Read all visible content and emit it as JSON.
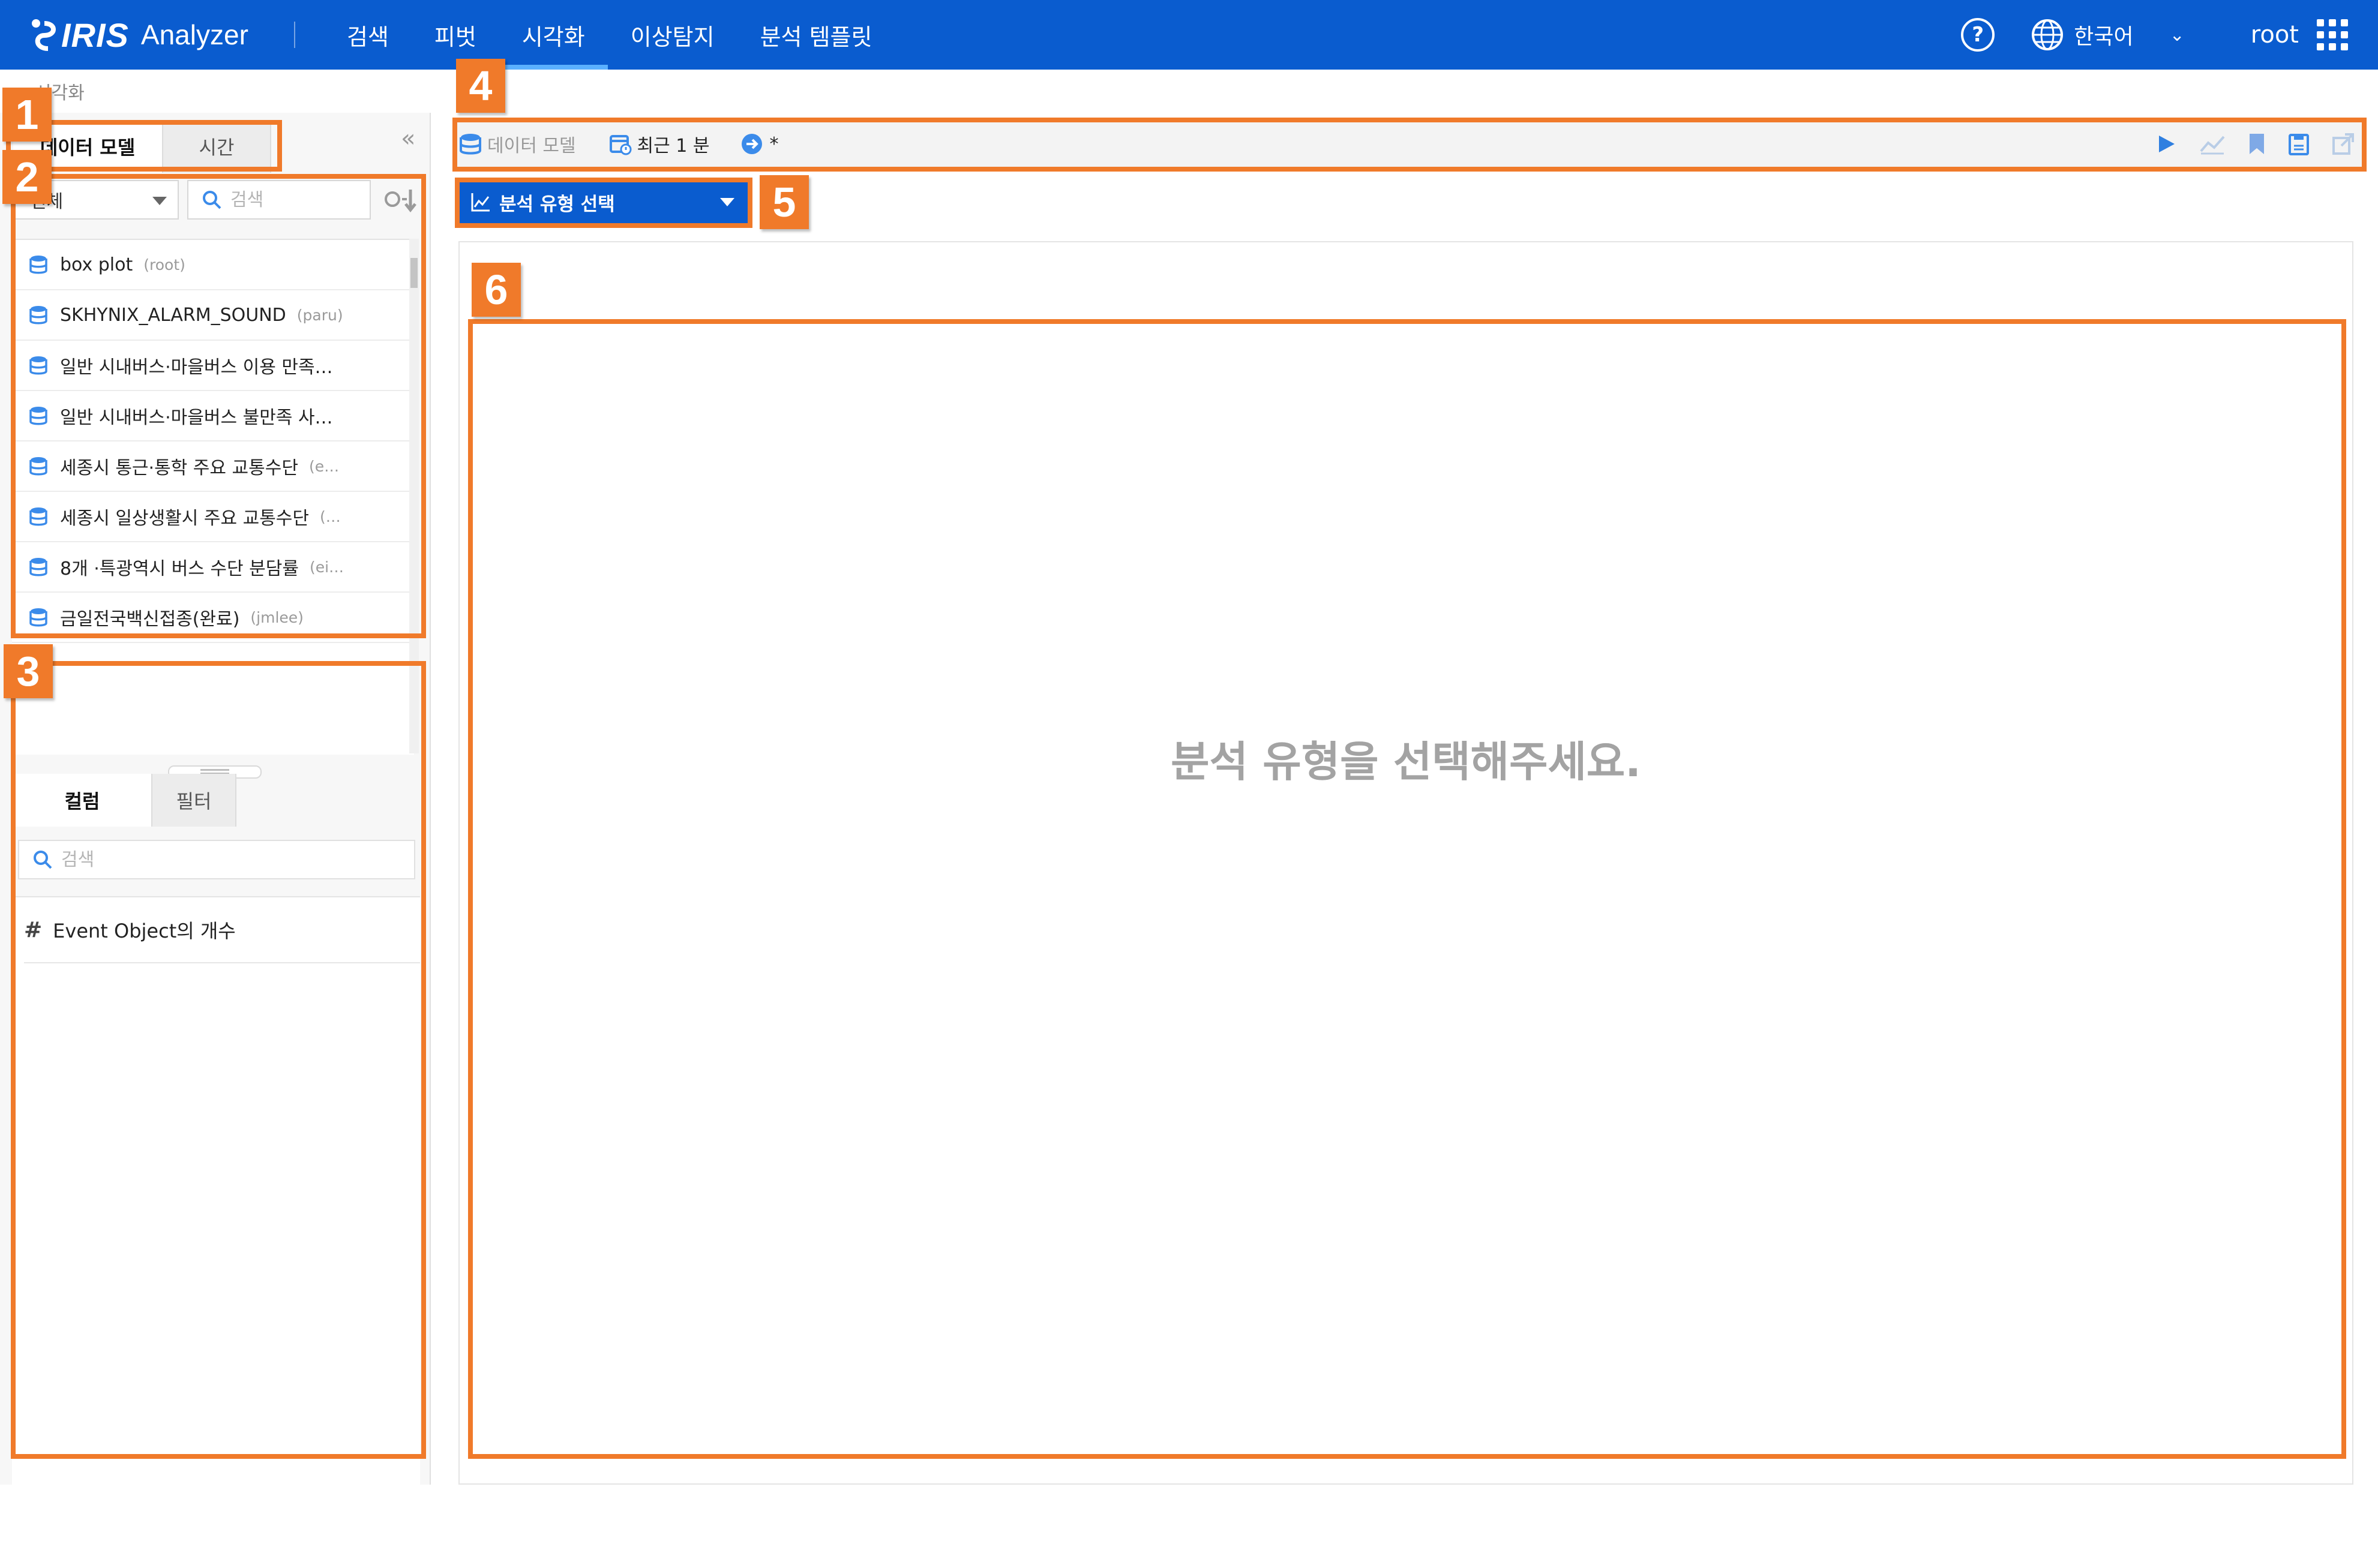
{
  "app": {
    "brand_mark": "IRIS",
    "brand_name": "Analyzer"
  },
  "nav": {
    "items": [
      {
        "label": "검색"
      },
      {
        "label": "피벗"
      },
      {
        "label": "시각화",
        "active": true
      },
      {
        "label": "이상탐지"
      },
      {
        "label": "분석 템플릿"
      }
    ],
    "language": "한국어",
    "user": "root"
  },
  "breadcrumb": "시각화",
  "sidebar": {
    "tabs": [
      {
        "label": "데이터 모델",
        "active": true
      },
      {
        "label": "시간"
      }
    ],
    "scope_select": "전체",
    "search_placeholder": "검색",
    "models": [
      {
        "name": "box plot",
        "owner": "(root)"
      },
      {
        "name": "SKHYNIX_ALARM_SOUND",
        "owner": "(paru)"
      },
      {
        "name": "일반 시내버스·마을버스 이용 만족…",
        "owner": ""
      },
      {
        "name": "일반 시내버스·마을버스 불만족 사…",
        "owner": ""
      },
      {
        "name": "세종시 통근·통학 주요 교통수단",
        "owner": "(e…"
      },
      {
        "name": "세종시 일상생활시 주요 교통수단",
        "owner": "(…"
      },
      {
        "name": "8개 ·특광역시 버스 수단 분담률",
        "owner": "(ei…"
      },
      {
        "name": "금일전국백신접종(완료)",
        "owner": "(jmlee)"
      }
    ],
    "column_tabs": [
      {
        "label": "컬럼",
        "active": true
      },
      {
        "label": "필터"
      }
    ],
    "column_search_placeholder": "검색",
    "columns": [
      {
        "type_symbol": "#",
        "name": "Event Object의 개수"
      }
    ]
  },
  "toolbar": {
    "data_model": "데이터 모델",
    "time_range": "최근 1 분",
    "target": "*"
  },
  "analysis": {
    "select_label": "분석 유형 선택",
    "empty_message": "분석 유형을 선택해주세요."
  },
  "annotations": [
    "1",
    "2",
    "3",
    "4",
    "5",
    "6"
  ],
  "colors": {
    "brand_blue": "#0a5ccf",
    "annotation_orange": "#f07a2a"
  }
}
